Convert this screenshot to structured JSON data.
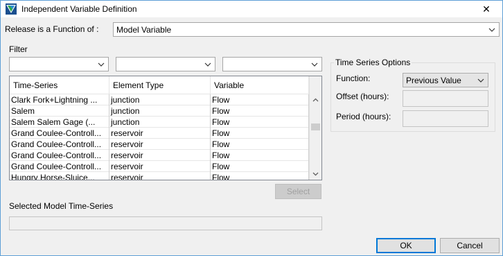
{
  "window": {
    "title": "Independent Variable Definition",
    "close_glyph": "✕"
  },
  "release": {
    "label": "Release is a Function of :",
    "value": "Model Variable"
  },
  "filter": {
    "label": "Filter",
    "combos": [
      "",
      "",
      ""
    ]
  },
  "grid": {
    "columns": [
      "Time-Series",
      "Element Type",
      "Variable"
    ],
    "rows": [
      [
        "Clark Fork+Lightning ...",
        "junction",
        "Flow"
      ],
      [
        "Salem",
        "junction",
        "Flow"
      ],
      [
        "Salem Salem Gage (...",
        "junction",
        "Flow"
      ],
      [
        "Grand Coulee-Controll...",
        "reservoir",
        "Flow"
      ],
      [
        "Grand Coulee-Controll...",
        "reservoir",
        "Flow"
      ],
      [
        "Grand Coulee-Controll...",
        "reservoir",
        "Flow"
      ],
      [
        "Grand Coulee-Controll...",
        "reservoir",
        "Flow"
      ],
      [
        "Hungry Horse-Sluice...",
        "reservoir",
        "Flow"
      ]
    ]
  },
  "select_button": "Select",
  "selected_label": "Selected Model Time-Series",
  "selected_value": "",
  "ts_options": {
    "title": "Time Series Options",
    "function_label": "Function:",
    "function_value": "Previous Value",
    "offset_label": "Offset (hours):",
    "offset_value": "",
    "period_label": "Period (hours):",
    "period_value": ""
  },
  "buttons": {
    "ok": "OK",
    "cancel": "Cancel"
  }
}
